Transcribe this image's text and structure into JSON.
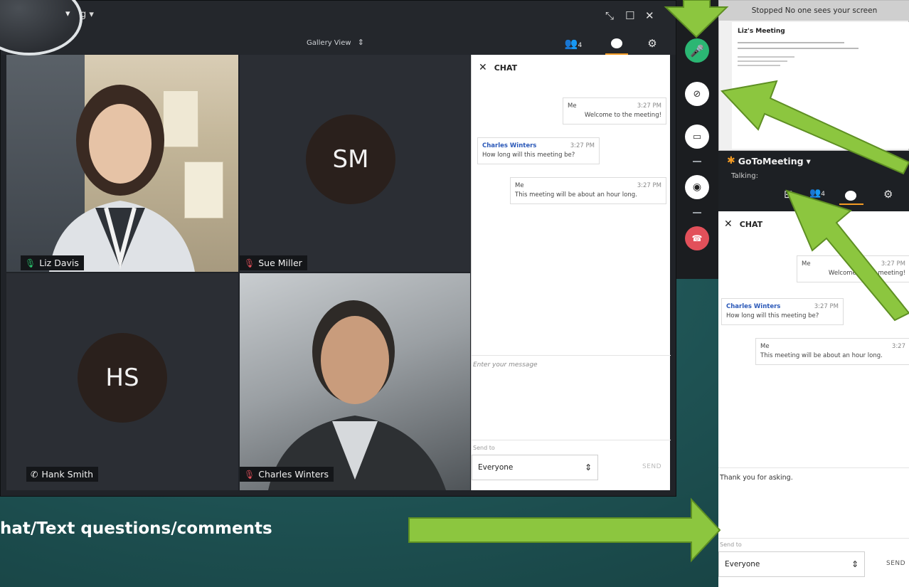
{
  "colors": {
    "slide_bg": "#1f5455",
    "arrow_green": "#8cc63f",
    "mic_green": "#29c16b",
    "end_red": "#e2505a",
    "sender_blue": "#2a58b8",
    "gtm_orange": "#f39b24"
  },
  "window": {
    "title_fragment": "g",
    "title_menu_icon": "dropdown-caret",
    "controls": [
      "collapse-icon",
      "maximize-icon",
      "close-icon"
    ]
  },
  "toolbar": {
    "view_label": "Gallery View",
    "participants_count": "4",
    "icons": [
      "updown-chevron-icon",
      "participants-icon",
      "chat-bubble-icon",
      "gear-icon"
    ]
  },
  "participants": [
    {
      "name": "Liz Davis",
      "status": "mic-on",
      "type": "video"
    },
    {
      "name": "Sue Miller",
      "status": "mic-muted",
      "type": "avatar",
      "initials": "SM"
    },
    {
      "name": "Hank Smith",
      "status": "phone",
      "type": "avatar",
      "initials": "HS"
    },
    {
      "name": "Charles Winters",
      "status": "mic-muted",
      "type": "video"
    }
  ],
  "chat": {
    "title": "CHAT",
    "messages": [
      {
        "sender": "Me",
        "time": "3:27 PM",
        "text": "Welcome to the meeting!",
        "side": "right"
      },
      {
        "sender": "Charles Winters",
        "time": "3:27 PM",
        "text": "How long will this meeting be?",
        "side": "left"
      },
      {
        "sender": "Me",
        "time": "3:27 PM",
        "text": "This meeting will be about an hour long.",
        "side": "right"
      }
    ],
    "input_placeholder": "Enter your message",
    "send_to_label": "Send to",
    "recipient": "Everyone",
    "send_label": "SEND"
  },
  "controls_bar": {
    "buttons": [
      "microphone-icon",
      "camera-off-icon",
      "screen-share-icon",
      "record-icon",
      "hang-up-icon"
    ]
  },
  "screen_preview": {
    "status": "Stopped  No one sees your screen",
    "doc_title": "Liz's Meeting"
  },
  "compact": {
    "brand": "GoToMeeting",
    "talking_label": "Talking:",
    "participants_count": "4",
    "chat_title": "CHAT",
    "messages": [
      {
        "sender": "Me",
        "time": "3:27 PM",
        "text": "Welcome to the meeting!"
      },
      {
        "sender": "Charles Winters",
        "time": "3:27 PM",
        "text": "How long will this meeting be?"
      },
      {
        "sender": "Me",
        "time": "3:27",
        "text": "This meeting will be about an hour long."
      }
    ],
    "draft_message": "Thank you for asking.",
    "send_to_label": "Send to",
    "recipient": "Everyone",
    "send_label": "SEND"
  },
  "caption": "hat/Text questions/comments"
}
